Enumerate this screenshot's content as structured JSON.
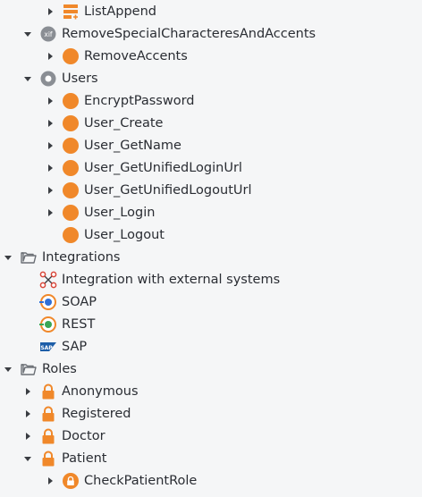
{
  "tree": {
    "items": [
      {
        "label": "ListAppend",
        "icon": "list-append-icon",
        "level": 2,
        "toggle": "collapsed"
      },
      {
        "label": "RemoveSpecialCharacteresAndAccents",
        "icon": "xif-module-icon",
        "level": 1,
        "toggle": "expanded"
      },
      {
        "label": "RemoveAccents",
        "icon": "action-icon",
        "level": 2,
        "toggle": "collapsed"
      },
      {
        "label": "Users",
        "icon": "users-module-icon",
        "level": 1,
        "toggle": "expanded"
      },
      {
        "label": "EncryptPassword",
        "icon": "action-icon",
        "level": 2,
        "toggle": "collapsed"
      },
      {
        "label": "User_Create",
        "icon": "action-icon",
        "level": 2,
        "toggle": "collapsed"
      },
      {
        "label": "User_GetName",
        "icon": "action-icon",
        "level": 2,
        "toggle": "collapsed"
      },
      {
        "label": "User_GetUnifiedLoginUrl",
        "icon": "action-icon",
        "level": 2,
        "toggle": "collapsed"
      },
      {
        "label": "User_GetUnifiedLogoutUrl",
        "icon": "action-icon",
        "level": 2,
        "toggle": "collapsed"
      },
      {
        "label": "User_Login",
        "icon": "action-icon",
        "level": 2,
        "toggle": "collapsed"
      },
      {
        "label": "User_Logout",
        "icon": "action-icon",
        "level": 2,
        "toggle": "none"
      },
      {
        "label": "Integrations",
        "icon": "folder-open-icon",
        "level": 0,
        "toggle": "expanded"
      },
      {
        "label": "Integration with external systems",
        "icon": "integration-icon",
        "level": 1,
        "toggle": "none"
      },
      {
        "label": "SOAP",
        "icon": "soap-icon",
        "level": 1,
        "toggle": "none"
      },
      {
        "label": "REST",
        "icon": "rest-icon",
        "level": 1,
        "toggle": "none"
      },
      {
        "label": "SAP",
        "icon": "sap-icon",
        "level": 1,
        "toggle": "none"
      },
      {
        "label": "Roles",
        "icon": "folder-open-icon",
        "level": 0,
        "toggle": "expanded"
      },
      {
        "label": "Anonymous",
        "icon": "lock-icon",
        "level": 1,
        "toggle": "collapsed"
      },
      {
        "label": "Registered",
        "icon": "lock-icon",
        "level": 1,
        "toggle": "collapsed"
      },
      {
        "label": "Doctor",
        "icon": "lock-icon",
        "level": 1,
        "toggle": "collapsed"
      },
      {
        "label": "Patient",
        "icon": "lock-icon",
        "level": 1,
        "toggle": "expanded"
      },
      {
        "label": "CheckPatientRole",
        "icon": "role-check-icon",
        "level": 2,
        "toggle": "collapsed"
      }
    ]
  },
  "icon_text": {
    "xif": "xif",
    "sap": "SAP"
  },
  "colors": {
    "action_orange": "#f0882a",
    "lock_orange": "#f0882a",
    "folder_gray": "#6b6f75",
    "arrow_dark": "#3a3d42",
    "soap_blue": "#2f6fd6",
    "rest_green": "#3aa655",
    "sap_blue": "#1d5ea8",
    "integration_red": "#d9473a"
  }
}
